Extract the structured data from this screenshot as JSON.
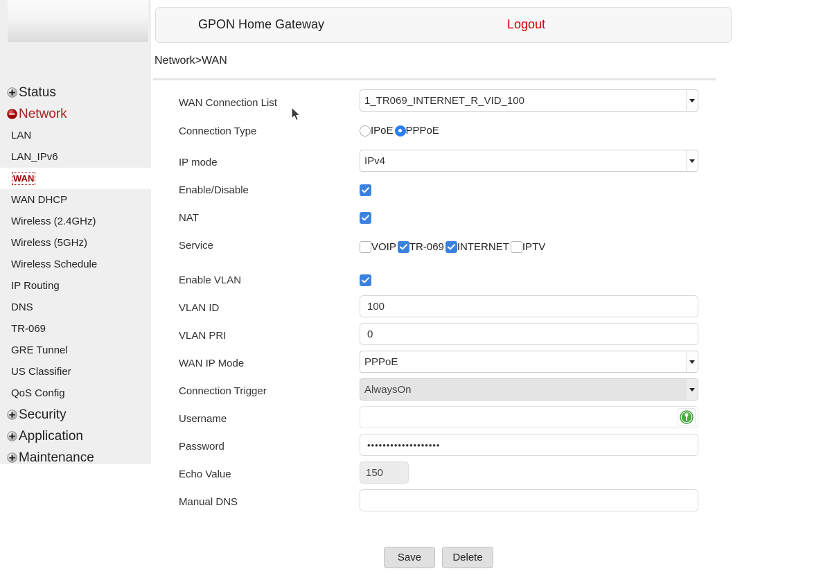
{
  "header": {
    "app_title": "GPON Home Gateway",
    "logout_label": "Logout",
    "breadcrumb": "Network>WAN"
  },
  "sidebar": {
    "groups": [
      {
        "label": "Status",
        "icon": "plus-circle-icon",
        "state": "collapsed"
      },
      {
        "label": "Network",
        "icon": "minus-circle-icon",
        "state": "expanded"
      },
      {
        "label": "Security",
        "icon": "plus-circle-icon",
        "state": "collapsed"
      },
      {
        "label": "Application",
        "icon": "plus-circle-icon",
        "state": "collapsed"
      },
      {
        "label": "Maintenance",
        "icon": "plus-circle-icon",
        "state": "collapsed"
      }
    ],
    "network_items": [
      {
        "label": "LAN",
        "active": false
      },
      {
        "label": "LAN_IPv6",
        "active": false
      },
      {
        "label": "WAN",
        "active": true
      },
      {
        "label": "WAN DHCP",
        "active": false
      },
      {
        "label": "Wireless (2.4GHz)",
        "active": false
      },
      {
        "label": "Wireless (5GHz)",
        "active": false
      },
      {
        "label": "Wireless Schedule",
        "active": false
      },
      {
        "label": "IP Routing",
        "active": false
      },
      {
        "label": "DNS",
        "active": false
      },
      {
        "label": "TR-069",
        "active": false
      },
      {
        "label": "GRE Tunnel",
        "active": false
      },
      {
        "label": "US Classifier",
        "active": false
      },
      {
        "label": "QoS Config",
        "active": false
      }
    ]
  },
  "form": {
    "wan_connection_list": {
      "label": "WAN Connection List",
      "value": "1_TR069_INTERNET_R_VID_100"
    },
    "connection_type": {
      "label": "Connection Type",
      "options": [
        {
          "label": "IPoE",
          "selected": false
        },
        {
          "label": "PPPoE",
          "selected": true
        }
      ]
    },
    "ip_mode": {
      "label": "IP mode",
      "value": "IPv4"
    },
    "enable_disable": {
      "label": "Enable/Disable",
      "checked": true
    },
    "nat": {
      "label": "NAT",
      "checked": true
    },
    "service": {
      "label": "Service",
      "options": [
        {
          "label": "VOIP",
          "checked": false
        },
        {
          "label": "TR-069",
          "checked": true
        },
        {
          "label": "INTERNET",
          "checked": true
        },
        {
          "label": "IPTV",
          "checked": false
        }
      ]
    },
    "enable_vlan": {
      "label": "Enable VLAN",
      "checked": true
    },
    "vlan_id": {
      "label": "VLAN ID",
      "value": "100"
    },
    "vlan_pri": {
      "label": "VLAN PRI",
      "value": "0"
    },
    "wan_ip_mode": {
      "label": "WAN IP Mode",
      "value": "PPPoE"
    },
    "connection_trigger": {
      "label": "Connection Trigger",
      "value": "AlwaysOn",
      "disabled": true
    },
    "username": {
      "label": "Username",
      "value": "",
      "badge_icon": "password-manager-icon"
    },
    "password": {
      "label": "Password",
      "value": "•••••••••••••••••••"
    },
    "echo_value": {
      "label": "Echo Value",
      "value": "150",
      "disabled": true
    },
    "manual_dns": {
      "label": "Manual DNS",
      "value": ""
    }
  },
  "actions": {
    "save_label": "Save",
    "delete_label": "Delete"
  },
  "colors": {
    "accent_red": "#cc0000",
    "checkbox_blue": "#3b82e0",
    "radio_blue": "#2d7ff0",
    "sidebar_bg": "#efefef",
    "badge_green": "#3a9b35"
  }
}
